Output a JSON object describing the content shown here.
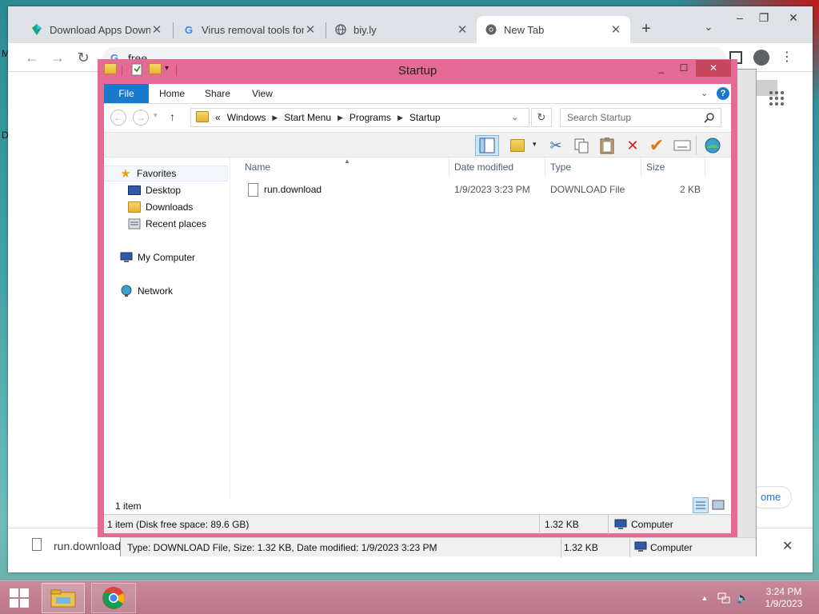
{
  "desktop": {
    "edge_letters": [
      "M",
      "D"
    ]
  },
  "chrome": {
    "tabs": [
      {
        "title": "Download Apps Downlo",
        "icon": "app-store-favicon"
      },
      {
        "title": "Virus removal tools for",
        "icon": "google-favicon"
      },
      {
        "title": "biy.ly",
        "icon": "globe-favicon"
      },
      {
        "title": "New Tab",
        "icon": "chrome-favicon",
        "active": true
      }
    ],
    "new_tab": "+",
    "omnibox_text": "free",
    "page_partial_button": "ome",
    "download": {
      "file": "run.download"
    }
  },
  "background_window": {
    "status_text": "Type: DOWNLOAD File, Size: 1.32 KB, Date modified: 1/9/2023 3:23 PM",
    "size": "1.32 KB",
    "location": "Computer"
  },
  "explorer": {
    "title": "Startup",
    "ribbon_tabs": [
      "File",
      "Home",
      "Share",
      "View"
    ],
    "breadcrumb_prefix": "«",
    "breadcrumb": [
      "Windows",
      "Start Menu",
      "Programs",
      "Startup"
    ],
    "search_placeholder": "Search Startup",
    "nav": {
      "favorites": "Favorites",
      "favorites_items": [
        "Desktop",
        "Downloads",
        "Recent places"
      ],
      "computer": "My Computer",
      "network": "Network"
    },
    "columns": [
      "Name",
      "Date modified",
      "Type",
      "Size"
    ],
    "files": [
      {
        "name": "run.download",
        "modified": "1/9/2023 3:23 PM",
        "type": "DOWNLOAD File",
        "size": "2 KB"
      }
    ],
    "item_count": "1 item",
    "statusbar": {
      "info": "1 item (Disk free space: 89.6 GB)",
      "size": "1.32 KB",
      "location": "Computer"
    }
  },
  "taskbar": {
    "time": "3:24 PM",
    "date": "1/9/2023"
  }
}
